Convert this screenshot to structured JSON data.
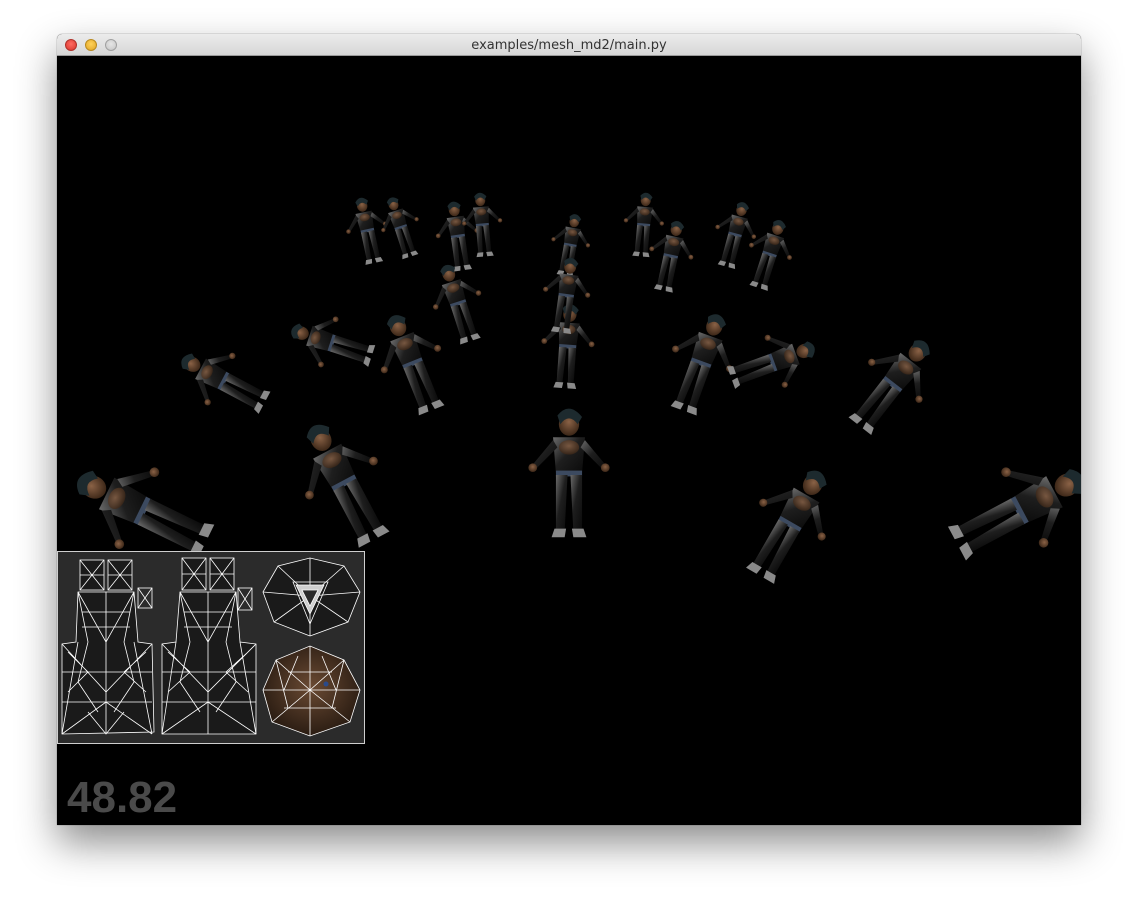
{
  "window": {
    "title": "examples/mesh_md2/main.py"
  },
  "hud": {
    "fps": "48.82"
  },
  "scene": {
    "background": "#000000",
    "character_count": 22,
    "character_name": "md2-character-model"
  },
  "texture_atlas": {
    "wire_color": "#ffffff",
    "background": "#2b2b2b"
  },
  "colors": {
    "close": "#ff5f57",
    "minimize": "#ffbd2e",
    "maximize": "#c8c8c8"
  }
}
